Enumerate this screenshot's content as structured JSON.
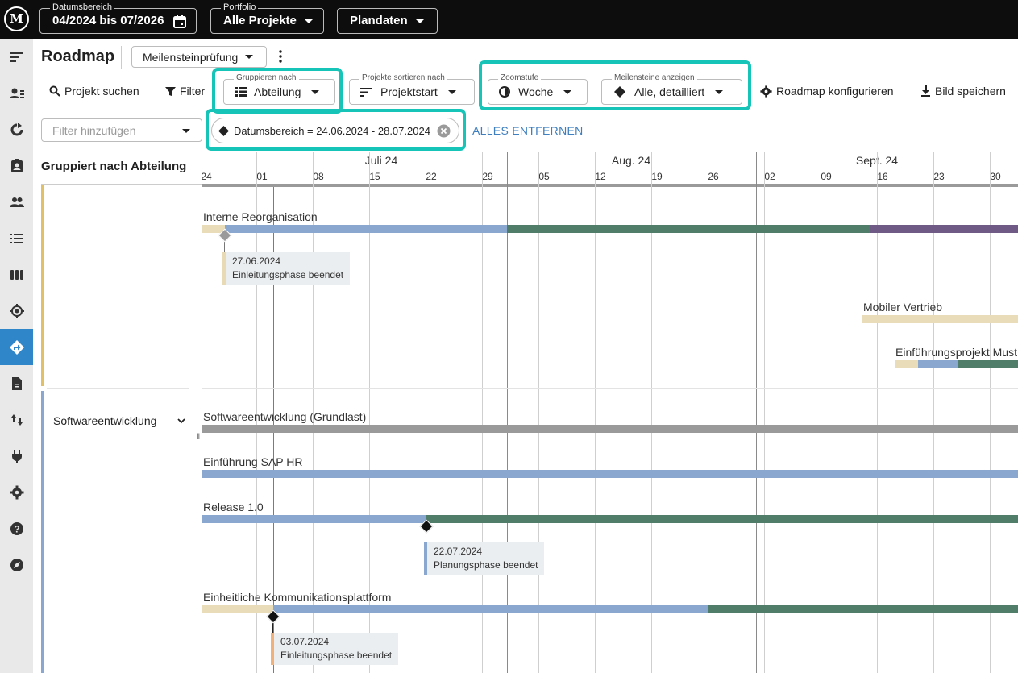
{
  "topbar": {
    "logo_text": "M",
    "date_range": {
      "label": "Datumsbereich",
      "value": "04/2024 bis 07/2026"
    },
    "portfolio": {
      "label": "Portfolio",
      "value": "Alle Projekte"
    },
    "plandata": {
      "value": "Plandaten"
    }
  },
  "sidebar": {
    "items": [
      {
        "icon": "roadmap-lines-icon"
      },
      {
        "icon": "user-list-icon"
      },
      {
        "icon": "refresh-icon"
      },
      {
        "icon": "contact-card-icon"
      },
      {
        "icon": "people-icon"
      },
      {
        "icon": "list-icon"
      },
      {
        "icon": "columns-icon"
      },
      {
        "icon": "target-icon"
      },
      {
        "icon": "directions-icon",
        "active": true
      },
      {
        "icon": "document-icon"
      },
      {
        "icon": "swap-vertical-icon"
      },
      {
        "icon": "plug-icon"
      },
      {
        "icon": "settings-icon"
      },
      {
        "icon": "help-icon"
      },
      {
        "icon": "compass-icon"
      }
    ]
  },
  "header": {
    "title": "Roadmap",
    "view_select": "Meilensteinprüfung",
    "more_icon": "more-vert-icon"
  },
  "toolbar": {
    "search": "Projekt suchen",
    "filter": "Filter",
    "group_by": {
      "label": "Gruppieren nach",
      "value": "Abteilung"
    },
    "sort_by": {
      "label": "Projekte sortieren nach",
      "value": "Projektstart"
    },
    "zoom": {
      "label": "Zoomstufe",
      "value": "Woche"
    },
    "milestones": {
      "label": "Meilensteine anzeigen",
      "value": "Alle, detailliert"
    },
    "configure": "Roadmap konfigurieren",
    "save_image": "Bild speichern"
  },
  "filterbar": {
    "placeholder": "Filter hinzufügen",
    "chip": "Datumsbereich = 24.06.2024 - 28.07.2024",
    "remove_all": "ALLES ENTFERNEN"
  },
  "gantt": {
    "group_header": "Gruppiert nach Abteilung",
    "months": [
      "Juli 24",
      "Aug. 24",
      "Sept. 24"
    ],
    "days": [
      "24",
      "01",
      "08",
      "15",
      "22",
      "29",
      "05",
      "12",
      "19",
      "26",
      "02",
      "09",
      "16",
      "23",
      "30"
    ],
    "groups": [
      {
        "name": "",
        "color": "#e2c06a"
      },
      {
        "name": "Softwareentwicklung",
        "color": "#8aa8cf"
      }
    ],
    "projects": [
      "Interne Reorganisation",
      "Mobiler Vertrieb",
      "Einführungsprojekt Must",
      "Softwareentwicklung (Grundlast)",
      "Einführung SAP HR",
      "Release 1.0",
      "Einheitliche Kommunikationsplattform"
    ],
    "milestones": [
      {
        "date": "27.06.2024",
        "text": "Einleitungsphase beendet"
      },
      {
        "date": "22.07.2024",
        "text": "Planungsphase beendet"
      },
      {
        "date": "03.07.2024",
        "text": "Einleitungsphase beendet"
      }
    ],
    "phase_colors": {
      "init": "#e9dcb8",
      "plan": "#8aa8cf",
      "exec": "#4f7d6a",
      "close": "#6e5a85",
      "base": "#9a9a9a"
    },
    "highlight_color": "#17c4b8"
  }
}
